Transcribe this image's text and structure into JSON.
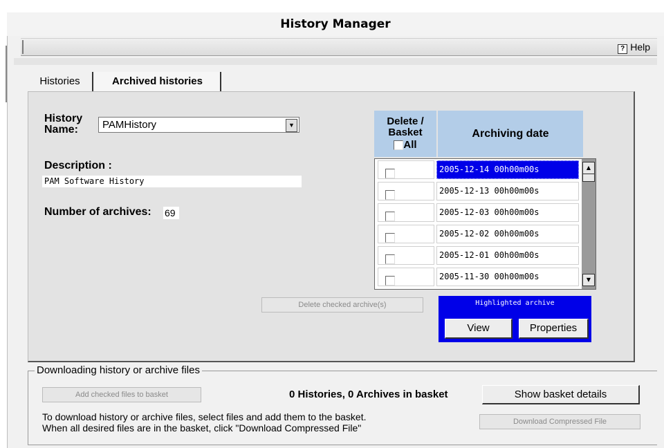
{
  "window": {
    "title": "History Manager"
  },
  "toolbar": {
    "help_label": "Help",
    "help_icon": "?"
  },
  "tabs": [
    {
      "label": "Histories",
      "active": false
    },
    {
      "label": "Archived histories",
      "active": true
    }
  ],
  "form": {
    "history_name_label": "History Name:",
    "history_name_value": "PAMHistory",
    "description_label": "Description :",
    "description_value": "PAM Software History",
    "num_archives_label": "Number of archives:",
    "num_archives_value": "69"
  },
  "archive_table": {
    "header_delete": "Delete / Basket",
    "header_all": "All",
    "header_date": "Archiving date",
    "rows": [
      {
        "date": "2005-12-14  00h00m00s",
        "selected": true
      },
      {
        "date": "2005-12-13  00h00m00s",
        "selected": false
      },
      {
        "date": "2005-12-03  00h00m00s",
        "selected": false
      },
      {
        "date": "2005-12-02  00h00m00s",
        "selected": false
      },
      {
        "date": "2005-12-01  00h00m00s",
        "selected": false
      },
      {
        "date": "2005-11-30  00h00m00s",
        "selected": false
      }
    ]
  },
  "actions": {
    "delete_checked_label": "Delete checked archive(s)",
    "highlighted_title": "Highlighted archive",
    "view_label": "View",
    "properties_label": "Properties"
  },
  "download": {
    "legend": "Downloading history or archive files",
    "add_to_basket_label": "Add checked files to basket",
    "basket_status": "0 Histories, 0 Archives in basket",
    "show_basket_label": "Show basket details",
    "instructions_line1": "To download history or archive files, select files and add them to the basket.",
    "instructions_line2": "When all desired files are in the basket, click \"Download Compressed File\"",
    "download_compressed_label": "Download Compressed File"
  },
  "colors": {
    "accent": "#0000e8",
    "header_bg": "#b3cde8",
    "panel_bg": "#e3e3e3"
  }
}
